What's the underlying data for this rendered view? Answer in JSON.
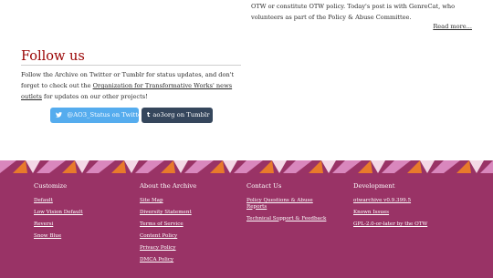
{
  "news": {
    "excerpt": "OTW or constitute OTW policy. Today's post is with GenreCat, who volunteers as part of the Policy & Abuse Committee.",
    "read_more": "Read more..."
  },
  "follow": {
    "title": "Follow us",
    "text_before": "Follow the Archive on Twitter or Tumblr for status updates, and don't forget to check out the ",
    "link_text": "Organization for Transformative Works' news outlets",
    "text_after": " for updates on our other projects!",
    "twitter_button": "@AO3_Status on Twitter",
    "twitter_icon": "twitter-bird-icon",
    "tumblr_button": "ao3org on Tumblr",
    "tumblr_icon": "tumblr-t-icon"
  },
  "footer": {
    "colors": {
      "background": "#993366",
      "pattern_orange": "#e87a2b",
      "pattern_pink": "#d987bd",
      "pattern_light": "#f4d9e6"
    },
    "columns": [
      {
        "heading": "Customize",
        "links": [
          "Default",
          "Low Vision Default",
          "Reversi",
          "Snow Blue"
        ]
      },
      {
        "heading": "About the Archive",
        "links": [
          "Site Map",
          "Diversity Statement",
          "Terms of Service",
          "Content Policy",
          "Privacy Policy",
          "DMCA Policy"
        ]
      },
      {
        "heading": "Contact Us",
        "links": [
          "Policy Questions & Abuse Reports",
          "Technical Support & Feedback"
        ]
      },
      {
        "heading": "Development",
        "links": [
          "otwarchive v0.9.399.5",
          "Known Issues",
          "GPL-2.0-or-later by the OTW"
        ]
      }
    ]
  },
  "brand": {
    "title_color": "#990000",
    "twitter_color": "#55acee",
    "tumblr_color": "#35465c"
  }
}
